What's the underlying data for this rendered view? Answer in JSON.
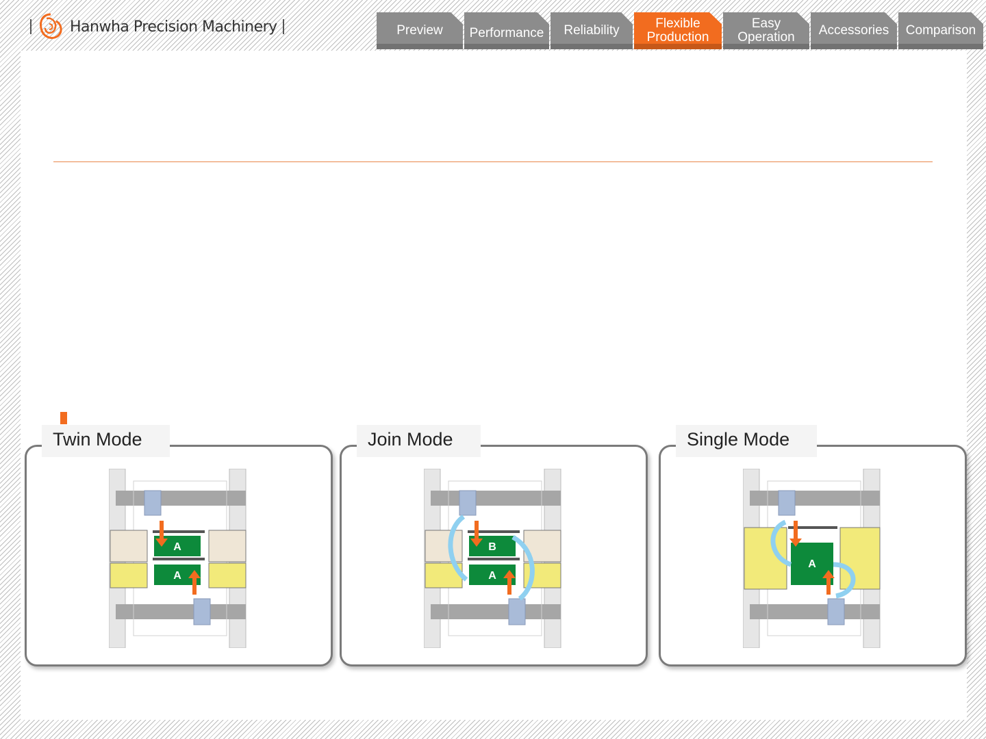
{
  "brand": {
    "name": "Hanwha Precision Machinery"
  },
  "nav": {
    "tabs": [
      {
        "label": "Preview"
      },
      {
        "label": "Performance"
      },
      {
        "label": "Reliability"
      },
      {
        "label": "Flexible Production",
        "active": true
      },
      {
        "label": "Easy Operation"
      },
      {
        "label": "Accessories"
      },
      {
        "label": "Comparison"
      }
    ]
  },
  "colors": {
    "accent": "#f26c1f",
    "tab": "#8c8c8c",
    "board": "#0d8a3b",
    "arrow_orange": "#f26c1f",
    "arrow_blue": "#8fd0f0"
  },
  "modes": [
    {
      "label": "Twin Mode",
      "boards": [
        "A",
        "A"
      ]
    },
    {
      "label": "Join Mode",
      "boards": [
        "B",
        "A"
      ]
    },
    {
      "label": "Single Mode",
      "boards": [
        "A"
      ]
    }
  ]
}
